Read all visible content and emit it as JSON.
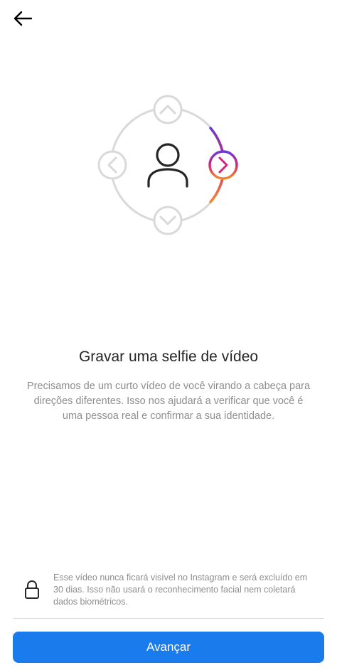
{
  "header": {
    "back_icon": "arrow-left-icon"
  },
  "illustration": {
    "icons": [
      "chevron-up-icon",
      "chevron-down-icon",
      "chevron-left-icon",
      "chevron-right-icon",
      "person-icon"
    ],
    "gradient_colors": [
      "#6a3bd1",
      "#d3257a",
      "#f58a2c"
    ],
    "neutral_color": "#d9d9d9"
  },
  "main": {
    "title": "Gravar uma selfie de vídeo",
    "description": "Precisamos de um curto vídeo de você virando a cabeça para direções diferentes. Isso nos ajudará a verificar que você é uma pessoa real e confirmar a sua identidade."
  },
  "privacy": {
    "icon": "lock-icon",
    "text": "Esse vídeo nunca ficará visível no Instagram e será excluído em 30 dias. Isso não usará o reconhecimento facial nem coletará dados biométricos."
  },
  "footer": {
    "next_label": "Avançar",
    "button_color": "#1a7cec"
  }
}
